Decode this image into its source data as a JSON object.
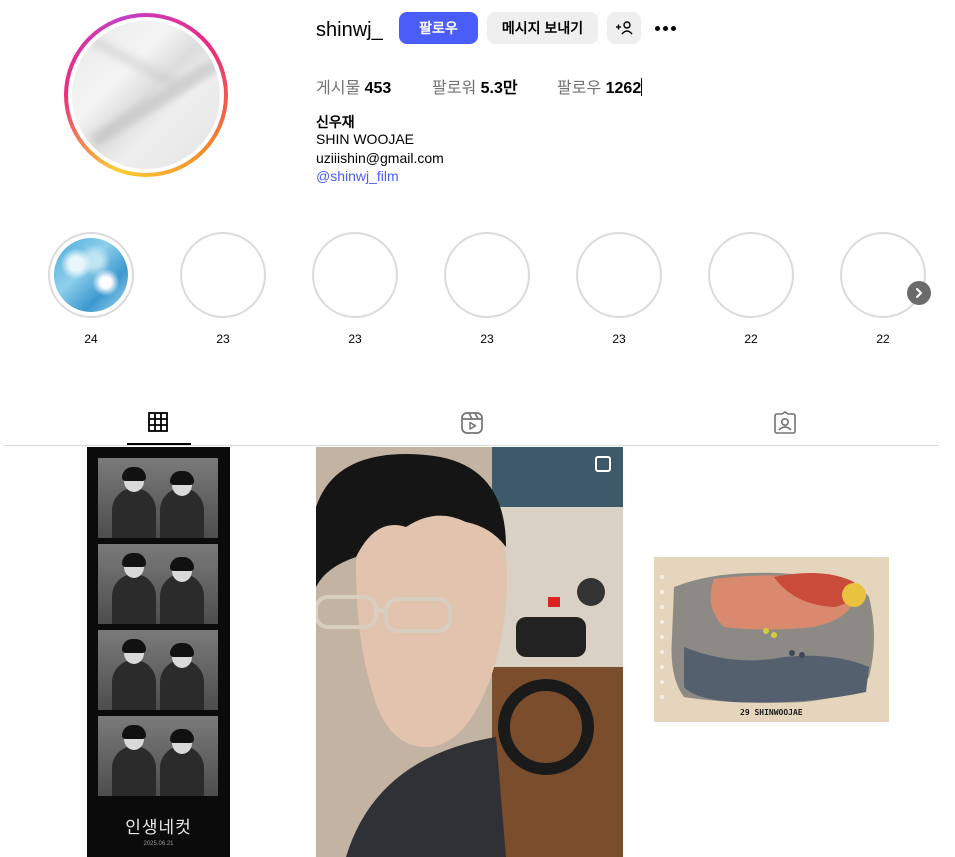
{
  "profile": {
    "username": "shinwj_",
    "follow_label": "팔로우",
    "message_label": "메시지 보내기",
    "add_user_icon": "add-person-icon",
    "more_icon": "ellipsis-icon"
  },
  "stats": {
    "posts_label": "게시물",
    "posts_value": "453",
    "followers_label": "팔로워",
    "followers_value": "5.3만",
    "following_label": "팔로우",
    "following_value": "1262"
  },
  "bio": {
    "name": "신우재",
    "line1": "SHIN WOOJAE",
    "line2": "uziiishin@gmail.com",
    "link": "@shinwj_film"
  },
  "highlights": [
    {
      "label": "24"
    },
    {
      "label": "23"
    },
    {
      "label": "23"
    },
    {
      "label": "23"
    },
    {
      "label": "23"
    },
    {
      "label": "22"
    },
    {
      "label": "22"
    }
  ],
  "tabs": [
    {
      "icon": "grid-icon",
      "active": true
    },
    {
      "icon": "reels-icon",
      "active": false
    },
    {
      "icon": "tagged-icon",
      "active": false
    }
  ],
  "posts": {
    "photo_strip_title": "인생네컷",
    "photo_strip_date": "2025.06.21",
    "painting_signature": "29 SHINWOOJAE"
  },
  "colors": {
    "accent": "#4a5df9",
    "secondary_button": "#efefef",
    "muted_text": "#737373",
    "divider": "#dbdbdb"
  }
}
